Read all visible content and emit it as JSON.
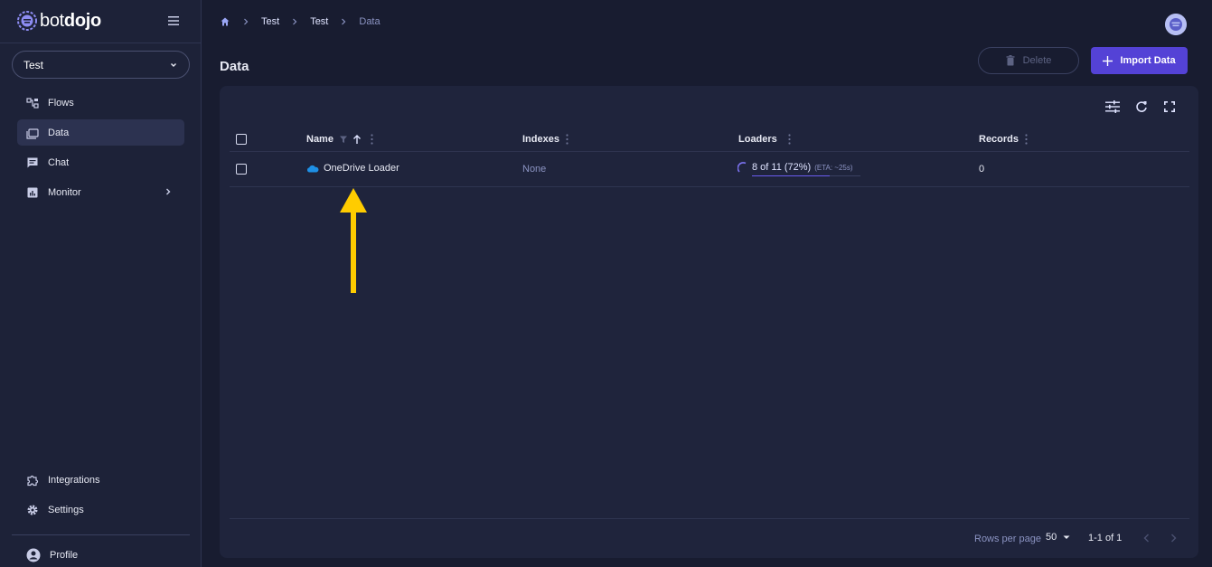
{
  "app": {
    "logo_light": "bot",
    "logo_bold": "dojo"
  },
  "sidebar": {
    "project": "Test",
    "items": [
      {
        "label": "Flows",
        "icon": "flows-icon"
      },
      {
        "label": "Data",
        "icon": "data-icon",
        "active": true
      },
      {
        "label": "Chat",
        "icon": "chat-icon"
      },
      {
        "label": "Monitor",
        "icon": "monitor-icon"
      },
      {
        "label": "Integrations",
        "icon": "integrations-icon"
      },
      {
        "label": "Settings",
        "icon": "gear-icon"
      },
      {
        "label": "Profile",
        "icon": "profile-icon"
      }
    ]
  },
  "breadcrumb": [
    "Test",
    "Test",
    "Data"
  ],
  "page": {
    "title": "Data"
  },
  "toolbar": {
    "delete_label": "Delete",
    "import_label": "Import Data"
  },
  "table": {
    "columns": [
      "Name",
      "Indexes",
      "Loaders",
      "Records"
    ],
    "rows": [
      {
        "name": "OneDrive Loader",
        "indexes": "None",
        "loaders": "8 of 11 (72%)",
        "loaders_eta": "(ETA: ~25s)",
        "loaders_progress": 0.72,
        "records": "0"
      }
    ]
  },
  "footer": {
    "rows_per_page_label": "Rows per page",
    "rows_per_page": "50",
    "range": "1-1 of 1"
  },
  "colors": {
    "accent": "#5442d6",
    "annotation_arrow": "#ffcc00",
    "onedrive": "#1e90e6"
  }
}
